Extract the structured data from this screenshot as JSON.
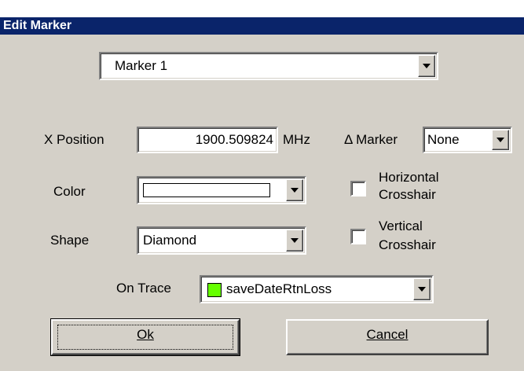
{
  "dialog": {
    "title": "Edit Marker",
    "marker_select": {
      "value": "Marker 1"
    },
    "x_position": {
      "label": "X Position",
      "value": "1900.509824",
      "unit": "MHz"
    },
    "delta_marker": {
      "label": "Δ Marker",
      "value": "None"
    },
    "color": {
      "label": "Color",
      "value_color": "#ffffff"
    },
    "horizontal_crosshair": {
      "label_line1": "Horizontal",
      "label_line2": "Crosshair",
      "checked": false
    },
    "shape": {
      "label": "Shape",
      "value": "Diamond"
    },
    "vertical_crosshair": {
      "label_line1": "Vertical",
      "label_line2": "Crosshair",
      "checked": false
    },
    "on_trace": {
      "label": "On Trace",
      "value": "saveDateRtnLoss",
      "swatch_color": "#66ff00"
    },
    "buttons": {
      "ok": "Ok",
      "cancel": "Cancel"
    }
  }
}
